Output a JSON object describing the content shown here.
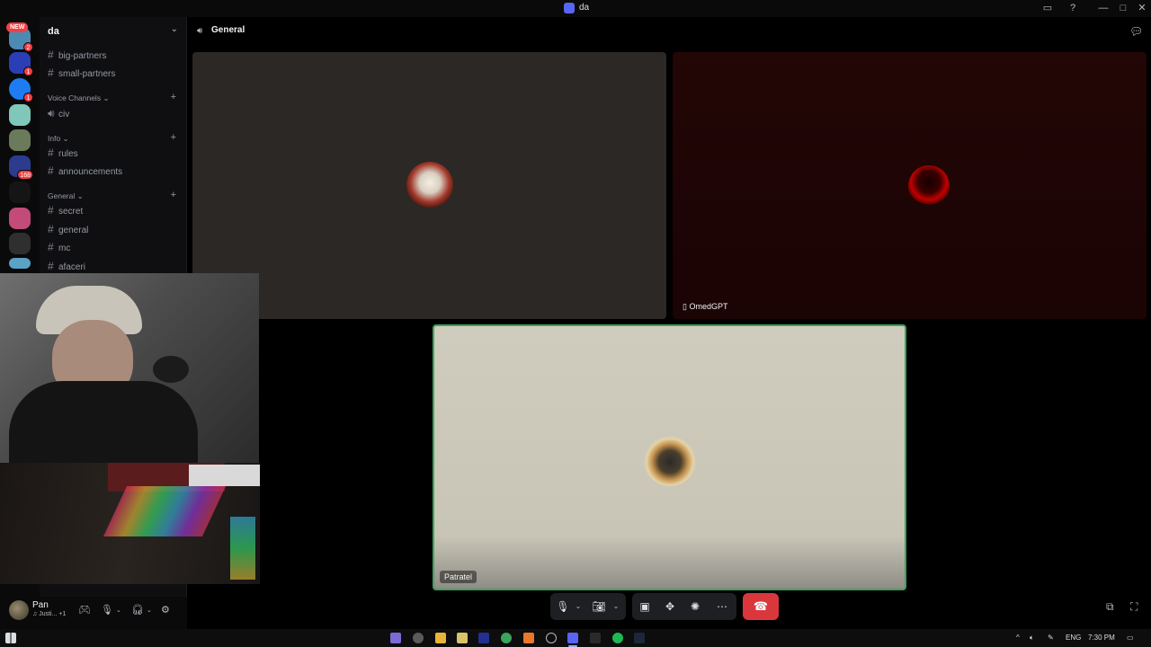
{
  "window": {
    "title": "da",
    "controls": {
      "minimize": "—",
      "maximize": "□",
      "close": "✕"
    }
  },
  "servers": {
    "new_label": "NEW",
    "badges": [
      "2",
      "1",
      "1",
      "168"
    ]
  },
  "guild": {
    "name": "da",
    "channels_top": [
      {
        "label": "big-partners"
      },
      {
        "label": "small-partners"
      }
    ],
    "categories": [
      {
        "name": "Voice Channels",
        "channels": [
          {
            "label": "civ"
          }
        ]
      },
      {
        "name": "Info",
        "channels": [
          {
            "label": "rules"
          },
          {
            "label": "announcements"
          }
        ]
      },
      {
        "name": "General",
        "channels": [
          {
            "label": "secret"
          },
          {
            "label": "general"
          },
          {
            "label": "mc"
          },
          {
            "label": "afaceri"
          }
        ]
      }
    ]
  },
  "user": {
    "name": "Pan",
    "status": "Justi...",
    "status_extra": "+1"
  },
  "call": {
    "channel": "General",
    "participants": [
      {
        "name": ""
      },
      {
        "name": "OmedGPT"
      },
      {
        "name": "Patratel"
      }
    ]
  },
  "colors": {
    "accent": "#5865f2",
    "speaking_border": "#3ba55c",
    "hangup": "#da373c",
    "notification": "#f23f43"
  },
  "taskbar": {
    "lang": "ENG",
    "time": "7:30 PM"
  }
}
